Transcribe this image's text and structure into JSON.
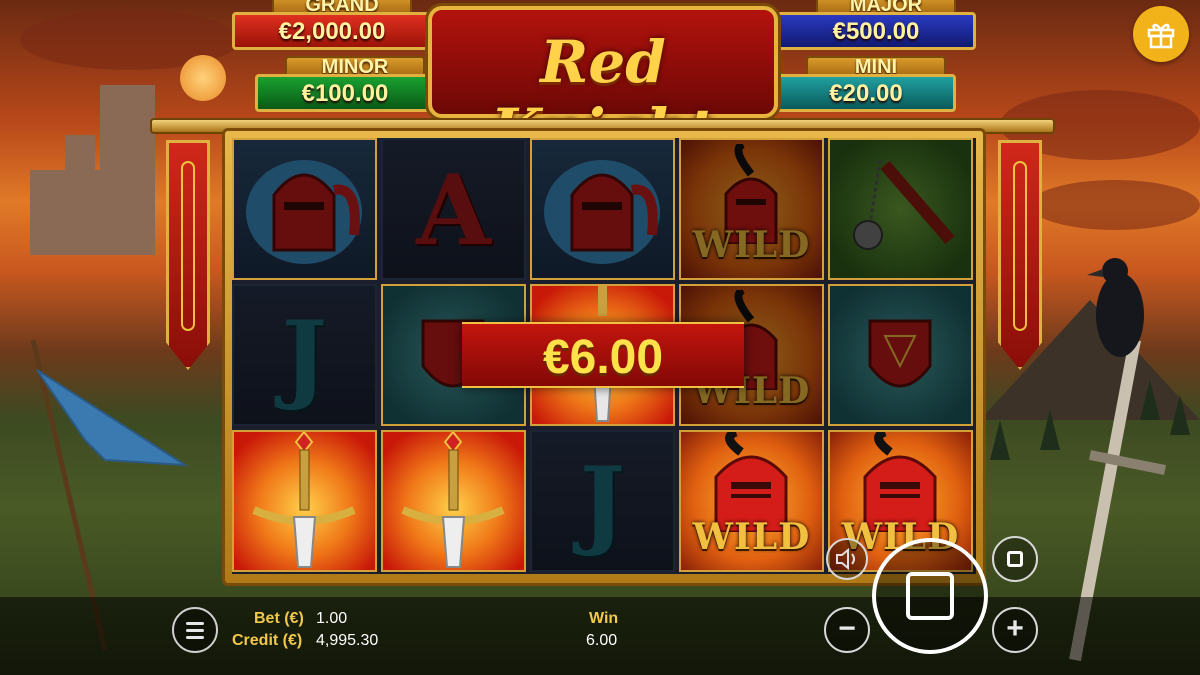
{
  "jackpots": {
    "grand": {
      "label": "GRAND",
      "value": "€2,000.00"
    },
    "major": {
      "label": "MAJOR",
      "value": "€500.00"
    },
    "minor": {
      "label": "MINOR",
      "value": "€100.00"
    },
    "mini": {
      "label": "MINI",
      "value": "€20.00"
    }
  },
  "game": {
    "title": "Red Knight"
  },
  "reels": {
    "rows": [
      [
        {
          "symbol": "knight-helmet",
          "highlight": false
        },
        {
          "symbol": "A",
          "highlight": false
        },
        {
          "symbol": "knight-helmet",
          "highlight": false
        },
        {
          "symbol": "wild",
          "label": "WILD",
          "highlight": false
        },
        {
          "symbol": "mace",
          "highlight": false
        }
      ],
      [
        {
          "symbol": "J",
          "highlight": false
        },
        {
          "symbol": "shield",
          "highlight": false
        },
        {
          "symbol": "sword",
          "highlight": true
        },
        {
          "symbol": "wild",
          "label": "WILD",
          "highlight": false
        },
        {
          "symbol": "shield",
          "highlight": false
        }
      ],
      [
        {
          "symbol": "sword",
          "highlight": true
        },
        {
          "symbol": "sword",
          "highlight": true
        },
        {
          "symbol": "J",
          "highlight": false
        },
        {
          "symbol": "wild",
          "label": "WILD",
          "highlight": true
        },
        {
          "symbol": "wild",
          "label": "WILD",
          "highlight": true
        }
      ]
    ]
  },
  "win_banner": {
    "amount": "€6.00"
  },
  "status": {
    "bet_label": "Bet (€)",
    "bet_value": "1.00",
    "credit_label": "Credit (€)",
    "credit_value": "4,995.30",
    "win_label": "Win",
    "win_value": "6.00"
  },
  "controls": {
    "menu_icon": "menu-icon",
    "sound_icon": "sound-icon",
    "autoplay_icon": "stop-square-icon",
    "spin_icon": "stop-square-icon",
    "minus_label": "−",
    "plus_label": "+"
  },
  "colors": {
    "accent_gold": "#f2c84a",
    "banner_red": "#c3150d",
    "gift_yellow": "#f2b31a"
  }
}
